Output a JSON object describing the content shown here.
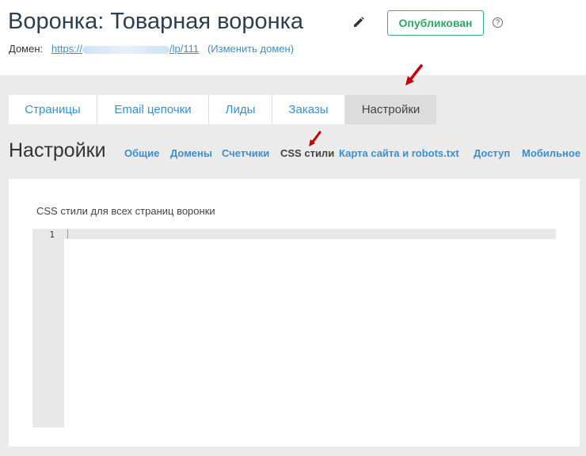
{
  "header": {
    "title": "Воронка: Товарная воронка",
    "publish_label": "Опубликован",
    "help_glyph": "?",
    "domain_label": "Домен:",
    "domain_url_start": "https://",
    "domain_url_end": "/lp/111",
    "change_domain": "(Изменить домен)",
    "status_color": "#2ea863"
  },
  "tabs": [
    {
      "label": "Страницы"
    },
    {
      "label": "Email цепочки"
    },
    {
      "label": "Лиды"
    },
    {
      "label": "Заказы"
    },
    {
      "label": "Настройки",
      "active": true
    }
  ],
  "settings": {
    "title": "Настройки",
    "subnav": [
      {
        "label": "Общие"
      },
      {
        "label": "Домены"
      },
      {
        "label": "Счетчики"
      },
      {
        "label": "CSS стили",
        "active": true
      },
      {
        "label": "Карта сайта и robots.txt"
      },
      {
        "label": "Доступ"
      },
      {
        "label": "Мобильное"
      }
    ]
  },
  "panel": {
    "label": "CSS стили для всех страниц воронки",
    "editor": {
      "line_number": "1",
      "content": ""
    }
  },
  "colors": {
    "accent": "#3a8fd0",
    "annotation_arrow": "#c00000",
    "background": "#ebebeb"
  }
}
